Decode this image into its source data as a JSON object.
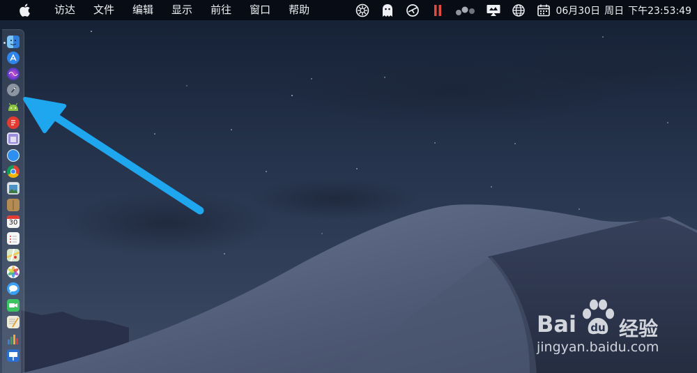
{
  "menubar": {
    "apple_icon": "apple-icon",
    "items": [
      "访达",
      "文件",
      "编辑",
      "显示",
      "前往",
      "窗口",
      "帮助"
    ],
    "status_icons": [
      "system-monitor-icon",
      "ghost-icon",
      "airdrop-icon",
      "pause-icon",
      "bubbles-icon",
      "display-icon",
      "globe-icon",
      "calendar-icon"
    ],
    "clock": {
      "date": "06月30日",
      "weekday": "周日",
      "time": "下午23:53:49"
    }
  },
  "dock": {
    "items": [
      {
        "name": "finder",
        "color": "#3b8ee8",
        "running": true
      },
      {
        "name": "app-store",
        "color": "#2e7de0"
      },
      {
        "name": "siri",
        "color": "#6b4fd0"
      },
      {
        "name": "launchpad",
        "color": "#8d95a3"
      },
      {
        "name": "android",
        "color": "#8cc63f"
      },
      {
        "name": "red-app",
        "color": "#e23b32"
      },
      {
        "name": "purple-app",
        "color": "#8f7fd6"
      },
      {
        "name": "safari",
        "color": "#2d8ff0"
      },
      {
        "name": "chrome",
        "color": "#f4b400",
        "running": true
      },
      {
        "name": "preview",
        "color": "#4d91c9"
      },
      {
        "name": "notes-box",
        "color": "#b48b52"
      },
      {
        "name": "calendar",
        "color": "#f4f4f4"
      },
      {
        "name": "reminders",
        "color": "#f6f6f6"
      },
      {
        "name": "maps",
        "color": "#66b36a"
      },
      {
        "name": "photos",
        "color": "#f2a83a"
      },
      {
        "name": "messages",
        "color": "#3aa0f6"
      },
      {
        "name": "facetime",
        "color": "#3bc461"
      },
      {
        "name": "textedit",
        "color": "#f0ead9"
      },
      {
        "name": "numbers",
        "color": "#43a047"
      },
      {
        "name": "keynote",
        "color": "#3d7fd9"
      }
    ],
    "calendar_day": "30"
  },
  "annotation": {
    "arrow_color": "#1ea7ee"
  },
  "watermark": {
    "brand_left": "Bai",
    "brand_right": "经验",
    "url": "jingyan.baidu.com"
  },
  "colors": {
    "sky_top": "#16233a",
    "sky_mid": "#2a3a55",
    "dune_light": "#5d6a86",
    "dune_dark": "#303a52"
  }
}
